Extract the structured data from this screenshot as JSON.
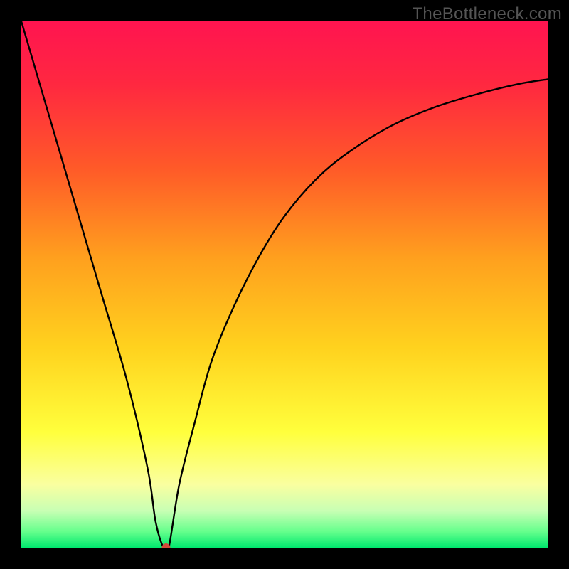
{
  "watermark": "TheBottleneck.com",
  "chart_data": {
    "type": "line",
    "title": "",
    "xlabel": "",
    "ylabel": "",
    "xlim": [
      0,
      100
    ],
    "ylim": [
      0,
      100
    ],
    "gradient_stops": [
      {
        "offset": 0,
        "color": "#ff1450"
      },
      {
        "offset": 12,
        "color": "#ff2840"
      },
      {
        "offset": 28,
        "color": "#ff5a28"
      },
      {
        "offset": 45,
        "color": "#ffa01e"
      },
      {
        "offset": 62,
        "color": "#ffd21e"
      },
      {
        "offset": 78,
        "color": "#ffff3c"
      },
      {
        "offset": 88,
        "color": "#faffa0"
      },
      {
        "offset": 93,
        "color": "#c8ffb4"
      },
      {
        "offset": 97,
        "color": "#64ff8c"
      },
      {
        "offset": 100,
        "color": "#00e86e"
      }
    ],
    "series": [
      {
        "name": "curve",
        "x": [
          0,
          5,
          10,
          15,
          20,
          24,
          25.5,
          27,
          28,
          30,
          33,
          36,
          40,
          45,
          50,
          56,
          62,
          70,
          78,
          86,
          94,
          100
        ],
        "values": [
          100,
          83,
          66,
          49,
          32,
          15,
          5,
          0,
          0,
          12,
          24,
          35,
          45,
          55,
          63,
          70,
          75,
          80,
          83.5,
          86,
          88,
          89
        ]
      }
    ],
    "marker": {
      "x": 27.5,
      "y": 0,
      "color": "#d44a3a",
      "radius": 6
    }
  }
}
